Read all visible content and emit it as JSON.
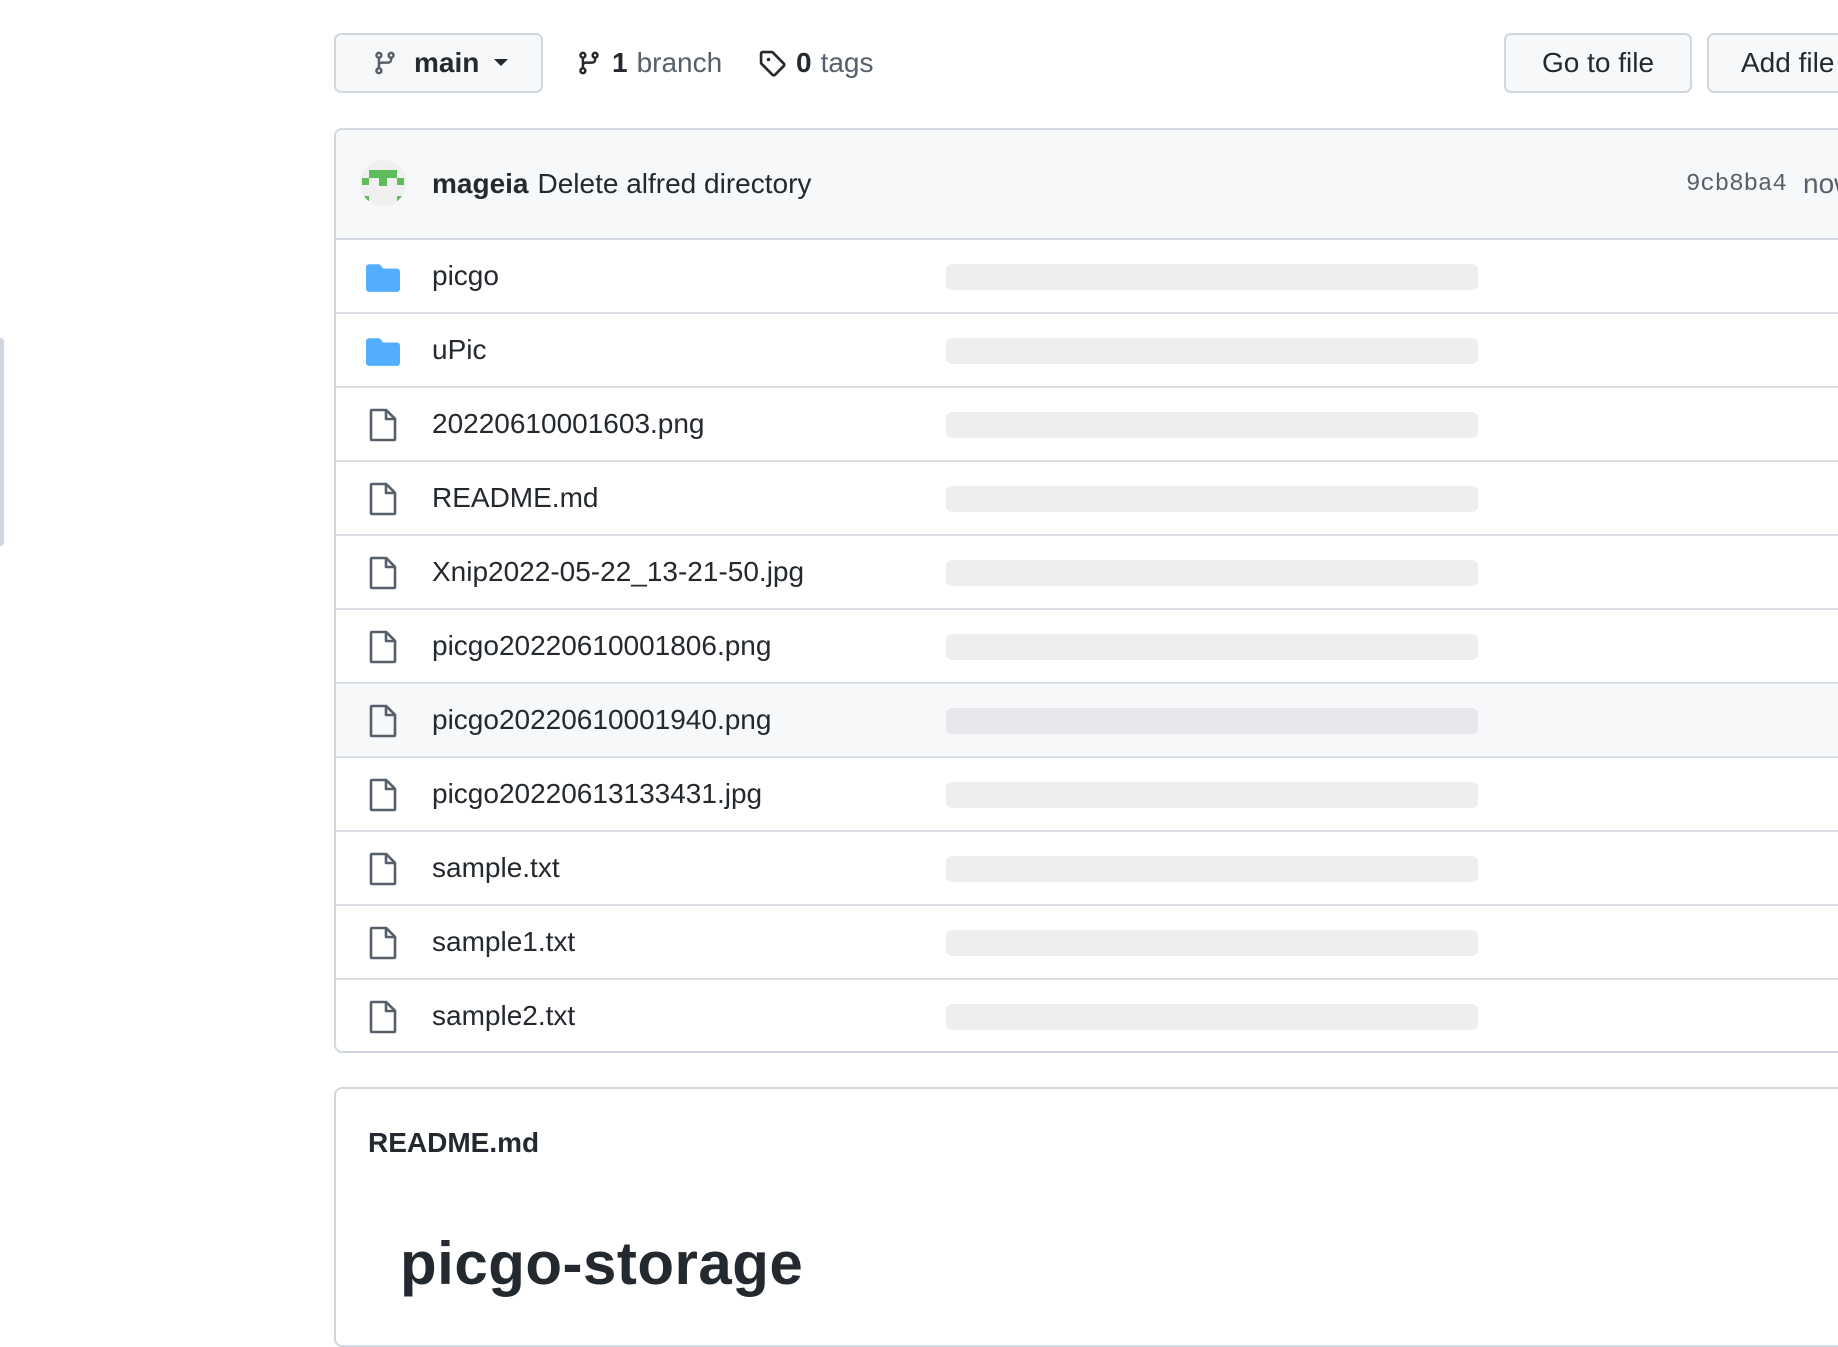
{
  "toolbar": {
    "branch_selector": "main",
    "branches_count": "1",
    "branches_label": "branch",
    "tags_count": "0",
    "tags_label": "tags",
    "go_to_file": "Go to file",
    "add_file": "Add file"
  },
  "commit": {
    "author": "mageia",
    "message": "Delete alfred directory",
    "sha": "9cb8ba4",
    "time": "now"
  },
  "files": [
    {
      "name": "picgo",
      "type": "folder"
    },
    {
      "name": "uPic",
      "type": "folder"
    },
    {
      "name": "20220610001603.png",
      "type": "file"
    },
    {
      "name": "README.md",
      "type": "file"
    },
    {
      "name": "Xnip2022-05-22_13-21-50.jpg",
      "type": "file"
    },
    {
      "name": "picgo20220610001806.png",
      "type": "file"
    },
    {
      "name": "picgo20220610001940.png",
      "type": "file",
      "hovered": true
    },
    {
      "name": "picgo20220613133431.jpg",
      "type": "file"
    },
    {
      "name": "sample.txt",
      "type": "file"
    },
    {
      "name": "sample1.txt",
      "type": "file"
    },
    {
      "name": "sample2.txt",
      "type": "file"
    }
  ],
  "readme": {
    "filename": "README.md",
    "heading": "picgo-storage"
  },
  "colors": {
    "folder": "#54aeff",
    "file_icon": "#57606a",
    "border": "#d0d7de",
    "header_bg": "#f6f8fa",
    "skeleton": "#eeeeee",
    "avatar_green": "#5cbd5a"
  },
  "icons": {
    "branch": "git-branch-icon",
    "tag": "tag-icon",
    "caret": "triangle-down-icon",
    "folder": "folder-icon",
    "file": "file-icon"
  }
}
